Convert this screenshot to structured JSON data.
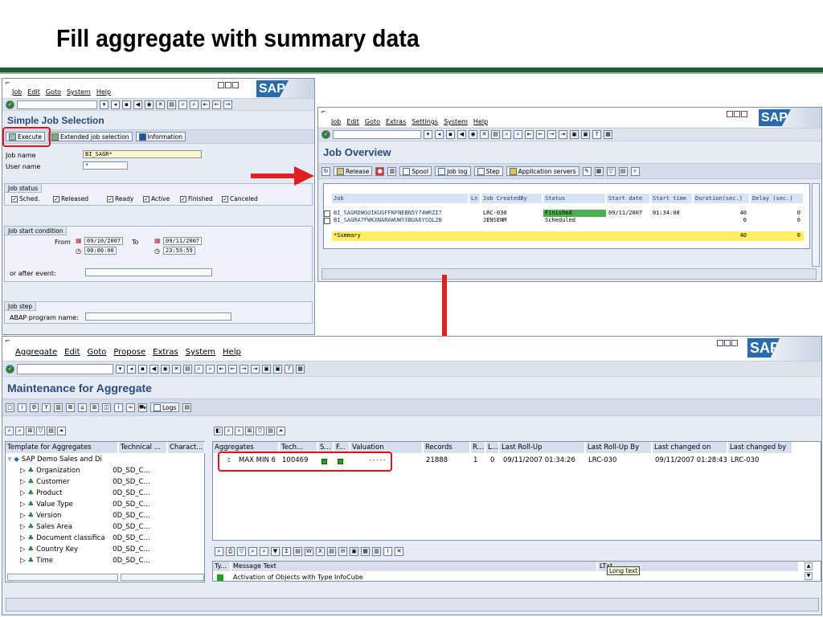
{
  "slide": {
    "title": "Fill aggregate with summary data"
  },
  "win1": {
    "menu": [
      "Job",
      "Edit",
      "Goto",
      "System",
      "Help"
    ],
    "screen_title": "Simple Job Selection",
    "buttons": {
      "execute": "Execute",
      "extended": "Extended job selection",
      "information": "Information"
    },
    "job_name_label": "Job name",
    "job_name_value": "BI_SAGR*",
    "user_name_label": "User name",
    "user_name_value": "*",
    "job_status_title": "Job status",
    "statuses": [
      "Sched.",
      "Released",
      "Ready",
      "Active",
      "Finished",
      "Canceled"
    ],
    "start_title": "Job start condition",
    "from_label": "From",
    "from_date": "09/10/2007",
    "from_time": "00:00:00",
    "to_label": "To",
    "to_date": "09/11/2007",
    "to_time": "23:59:59",
    "after_event_label": "or after event:",
    "job_step_title": "Job step",
    "abap_label": "ABAP program name:"
  },
  "win2": {
    "menu": [
      "Job",
      "Edit",
      "Goto",
      "Extras",
      "Settings",
      "System",
      "Help"
    ],
    "screen_title": "Job Overview",
    "buttons": {
      "release": "Release",
      "spool": "Spool",
      "joblog": "Job log",
      "step": "Step",
      "appservers": "Application servers"
    },
    "headers": [
      "Job",
      "Ln",
      "Job CreatedBy",
      "Status",
      "Start date",
      "Start time",
      "Duration(sec.)",
      "Delay (sec.)"
    ],
    "rows": [
      [
        "BI_SAGRDWGUIKUGFFNFNEBN5Y74WRZI7",
        "",
        "LRC-030",
        "Finished",
        "09/11/2007",
        "01:34:08",
        "40",
        "0"
      ],
      [
        "BI_SAGRA7FWKXNARAWUWYXBUA6YSQL2B",
        "",
        "JENSENM",
        "Scheduled",
        "",
        "",
        "0",
        "0"
      ]
    ],
    "summary": {
      "label": "*Summary",
      "duration": "40",
      "delay": "0"
    }
  },
  "win3": {
    "menu": [
      "Aggregate",
      "Edit",
      "Goto",
      "Propose",
      "Extras",
      "System",
      "Help"
    ],
    "screen_title": "Maintenance for Aggregate",
    "logs_label": "Logs",
    "tree_headers": [
      "Template for Aggregates",
      "Technical ...",
      "Charact..."
    ],
    "tree_root": "SAP Demo Sales and Di",
    "tree_items": [
      {
        "name": "Organization",
        "tech": "0D_SD_C..."
      },
      {
        "name": "Customer",
        "tech": "0D_SD_C..."
      },
      {
        "name": "Product",
        "tech": "0D_SD_C..."
      },
      {
        "name": "Value Type",
        "tech": "0D_SD_C..."
      },
      {
        "name": "Version",
        "tech": "0D_SD_C..."
      },
      {
        "name": "Sales Area",
        "tech": "0D_SD_C..."
      },
      {
        "name": "Document classifica",
        "tech": "0D_SD_C..."
      },
      {
        "name": "Country Key",
        "tech": "0D_SD_C..."
      },
      {
        "name": "Time",
        "tech": "0D_SD_C..."
      }
    ],
    "agg_headers": [
      "Aggregates",
      "Tech...",
      "S...",
      "F...",
      "Valuation",
      "Records",
      "R...",
      "L...",
      "Last Roll-Up",
      "Last Roll-Up By",
      "Last changed on",
      "Last changed by"
    ],
    "agg_row": {
      "name": "MAX MIN 6",
      "tech": "100469",
      "valuation": "-----",
      "records": "21888",
      "r": "1",
      "l": "0",
      "last_rollup": "09/11/2007 01:34:26",
      "rollup_by": "LRC-030",
      "changed_on": "09/11/2007 01:28:43",
      "changed_by": "LRC-030"
    },
    "msg_headers": [
      "Ty...",
      "Message Text",
      "LTxt"
    ],
    "msg_text": "Activation of Objects with Type InfoCube",
    "tooltip": "Long text"
  },
  "colors": {
    "accent_red": "#e0141e",
    "finished": "#4caf50",
    "summary": "#ffee66",
    "slide_bar": "#1e5e3b"
  }
}
